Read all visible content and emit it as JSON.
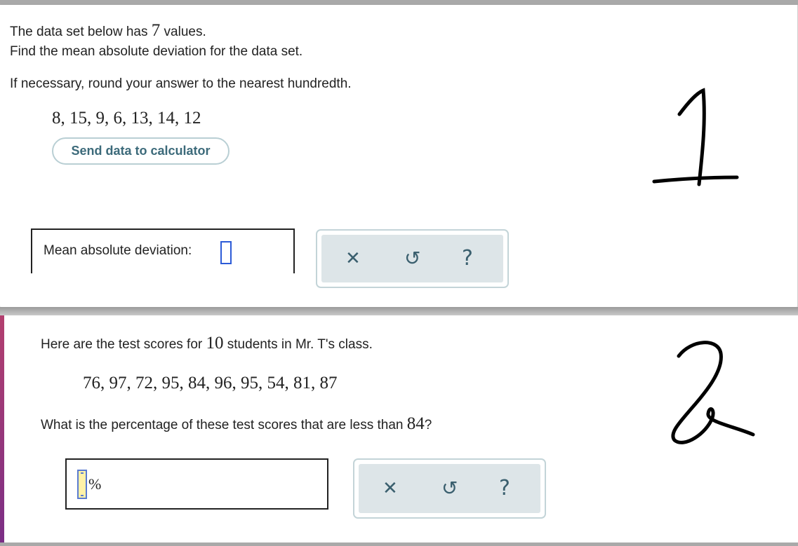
{
  "problem1": {
    "line1_prefix": "The data set below has ",
    "line1_number": "7",
    "line1_suffix": " values.",
    "line2": "Find the mean absolute deviation for the data set.",
    "line3": "If necessary, round your answer to the nearest hundredth.",
    "data_values": "8, 15, 9, 6, 13, 14, 12",
    "calc_button_label": "Send data to calculator",
    "answer_label": "Mean absolute deviation:",
    "handwritten_number": "1"
  },
  "problem2": {
    "line1_prefix": "Here are the test scores for ",
    "line1_number": "10",
    "line1_suffix": " students in Mr. T's class.",
    "data_values": "76, 97, 72, 95, 84, 96, 95, 54, 81, 87",
    "question_prefix": "What is the percentage of these test scores that are less than ",
    "question_number": "84",
    "question_suffix": "?",
    "percent_symbol": "%",
    "handwritten_number": "2"
  },
  "toolbar": {
    "clear_icon_glyph": "✕",
    "undo_icon_glyph": "↺",
    "help_icon_glyph": "?"
  },
  "colors": {
    "button_text": "#3c6a7a",
    "toolbar_bg": "#dde5e8",
    "cursor_border": "#2c5bd7"
  }
}
